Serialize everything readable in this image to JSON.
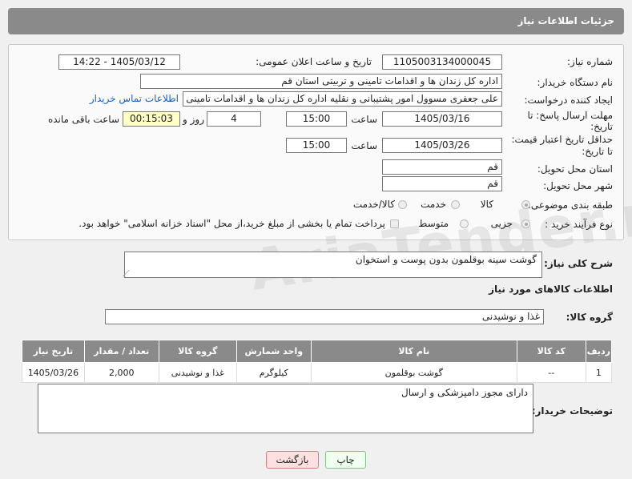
{
  "header": {
    "title": "جزئیات اطلاعات نیاز"
  },
  "form": {
    "need_number_label": "شماره نیاز:",
    "need_number": "1105003134000045",
    "announce_label": "تاریخ و ساعت اعلان عمومی:",
    "announce_value": "1405/03/12 - 14:22",
    "buyer_org_label": "نام دستگاه خریدار:",
    "buyer_org": "اداره کل زندان ها و اقدامات تامینی و تربیتی استان قم",
    "creator_label": "ایجاد کننده درخواست:",
    "creator": "علی جعفری مسوول امور پشتیبانی و نقلیه اداره کل زندان ها و اقدامات تامینی و",
    "contact_link": "اطلاعات تماس خریدار",
    "reply_deadline_label_1": "مهلت ارسال پاسخ: تا",
    "reply_deadline_label_2": "تاریخ:",
    "reply_date": "1405/03/16",
    "time_label": "ساعت",
    "reply_time": "15:00",
    "days_value": "4",
    "days_label": "روز و",
    "remaining_time": "00:15:03",
    "remaining_label": "ساعت باقی مانده",
    "validity_label_1": "حداقل تاریخ اعتبار قیمت:",
    "validity_label_2": "تا تاریخ:",
    "validity_date": "1405/03/26",
    "validity_time": "15:00",
    "province_label": "استان محل تحویل:",
    "province": "قم",
    "city_label": "شهر محل تحویل:",
    "city": "قم",
    "category_label": "طبقه بندی موضوعی:",
    "category_options": [
      "کالا",
      "خدمت",
      "کالا/خدمت"
    ],
    "process_label": "نوع فرآیند خرید :",
    "process_options": [
      "جزیی",
      "متوسط"
    ],
    "payment_note": "پرداخت تمام یا بخشی از مبلغ خرید،از محل \"اسناد خزانه اسلامی\" خواهد بود."
  },
  "summary": {
    "label": "شرح کلی نیاز:",
    "value": "گوشت سینه بوقلمون بدون پوست و استخوان"
  },
  "goods_section_title": "اطلاعات کالاهای مورد نیاز",
  "goods_group": {
    "label": "گروه کالا:",
    "value": "غذا و نوشیدنی"
  },
  "table": {
    "headers": [
      "ردیف",
      "کد کالا",
      "نام کالا",
      "واحد شمارش",
      "گروه کالا",
      "تعداد / مقدار",
      "تاریخ نیاز"
    ],
    "rows": [
      [
        "1",
        "--",
        "گوشت بوقلمون",
        "کیلوگرم",
        "غذا و نوشیدنی",
        "2,000",
        "1405/03/26"
      ]
    ]
  },
  "buyer_notes": {
    "label": "توضیحات خریدار:",
    "value": "دارای مجوز دامپزشکی و ارسال"
  },
  "buttons": {
    "print": "چاپ",
    "back": "بازگشت"
  },
  "watermark": "AriaTender.net"
}
